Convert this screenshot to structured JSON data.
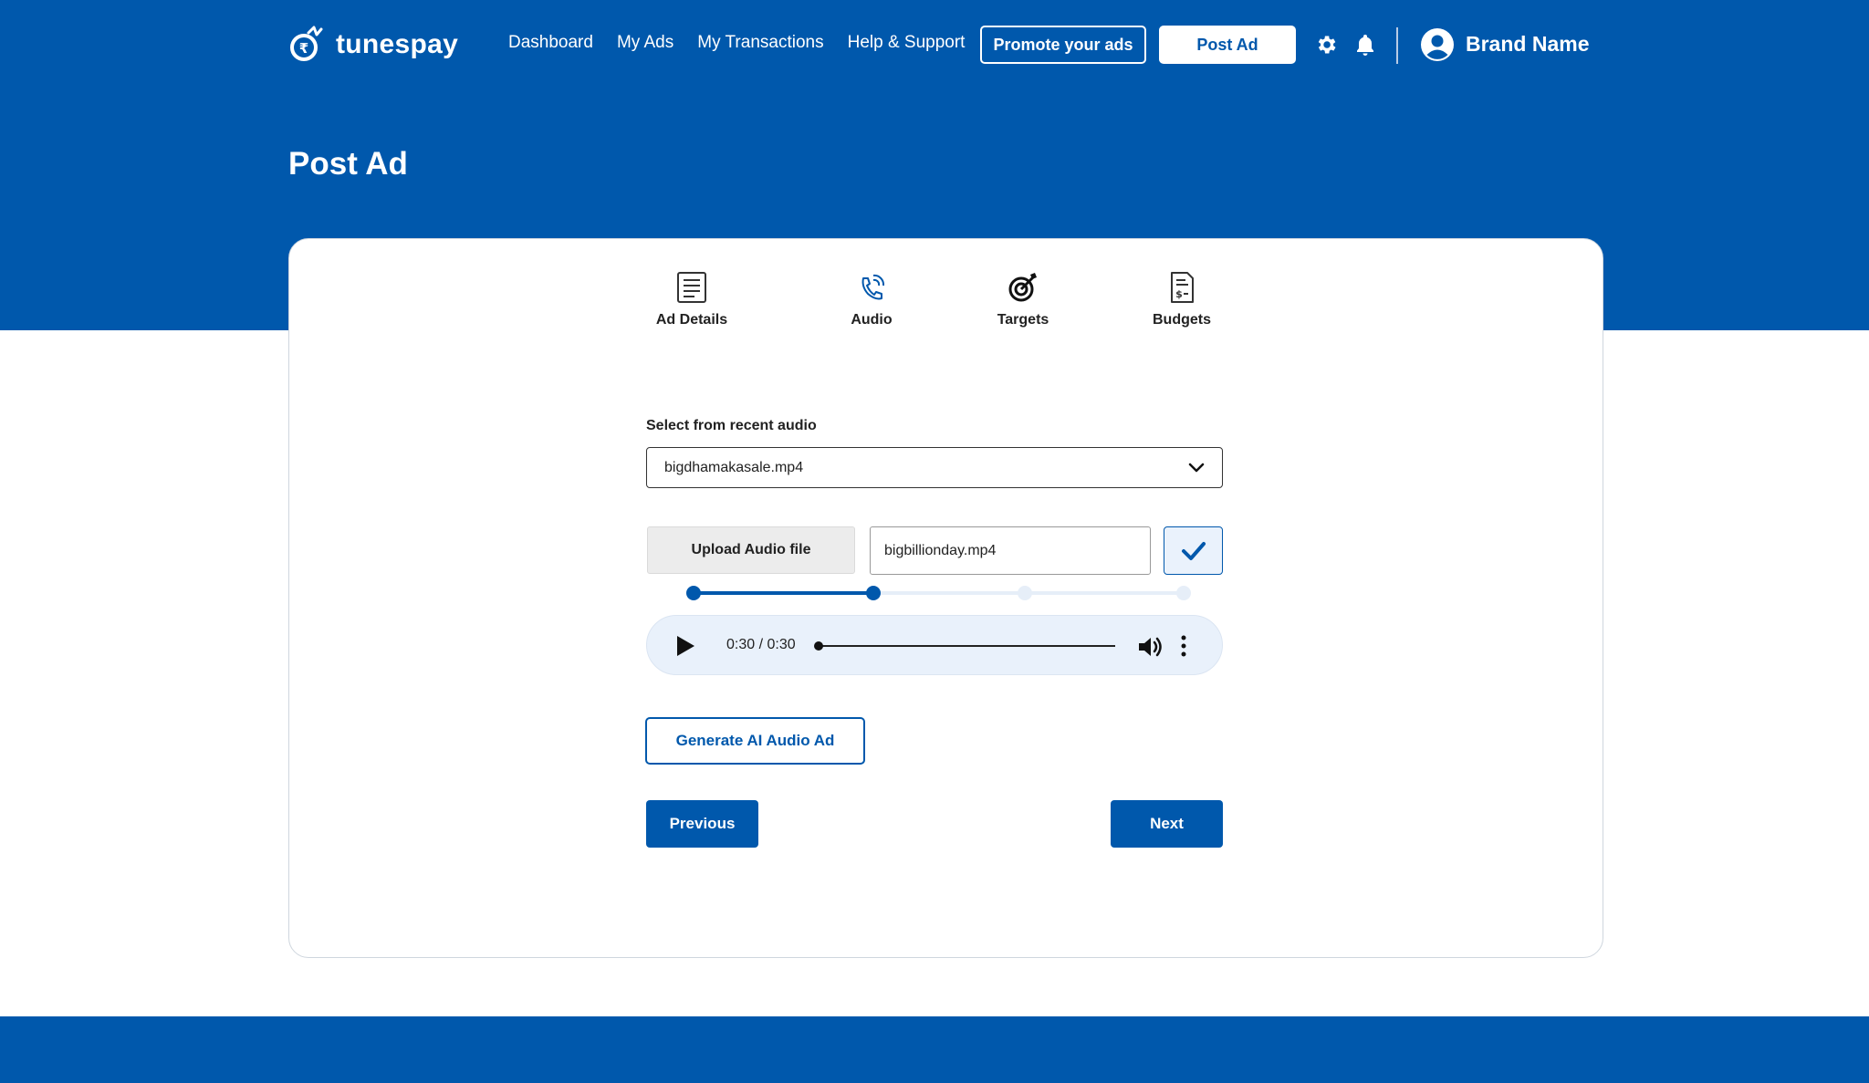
{
  "header": {
    "brand": "tunespay",
    "nav": [
      "Dashboard",
      "My Ads",
      "My Transactions",
      "Help & Support"
    ],
    "promote_label": "Promote your ads",
    "post_ad_label": "Post Ad",
    "user_name": "Brand Name",
    "icons": [
      "settings-icon",
      "bell-icon",
      "user-avatar-icon"
    ]
  },
  "page": {
    "title": "Post Ad"
  },
  "stepper": {
    "steps": [
      {
        "label": "Ad Details",
        "icon": "document-icon",
        "state": "completed"
      },
      {
        "label": "Audio",
        "icon": "phone-call-icon",
        "state": "active"
      },
      {
        "label": "Targets",
        "icon": "target-icon",
        "state": "pending"
      },
      {
        "label": "Budgets",
        "icon": "invoice-icon",
        "state": "pending"
      }
    ]
  },
  "form": {
    "recent_label": "Select from recent audio",
    "recent_value": "bigdhamakasale.mp4",
    "upload_label": "Upload Audio file",
    "file_value": "bigbillionday.mp4"
  },
  "player": {
    "time": "0:30 / 0:30"
  },
  "actions": {
    "generate_label": "Generate AI Audio Ad",
    "previous_label": "Previous",
    "next_label": "Next"
  },
  "colors": {
    "primary": "#0058ac",
    "track_inactive": "#e6eef8",
    "player_bg": "#e9f1fb"
  }
}
